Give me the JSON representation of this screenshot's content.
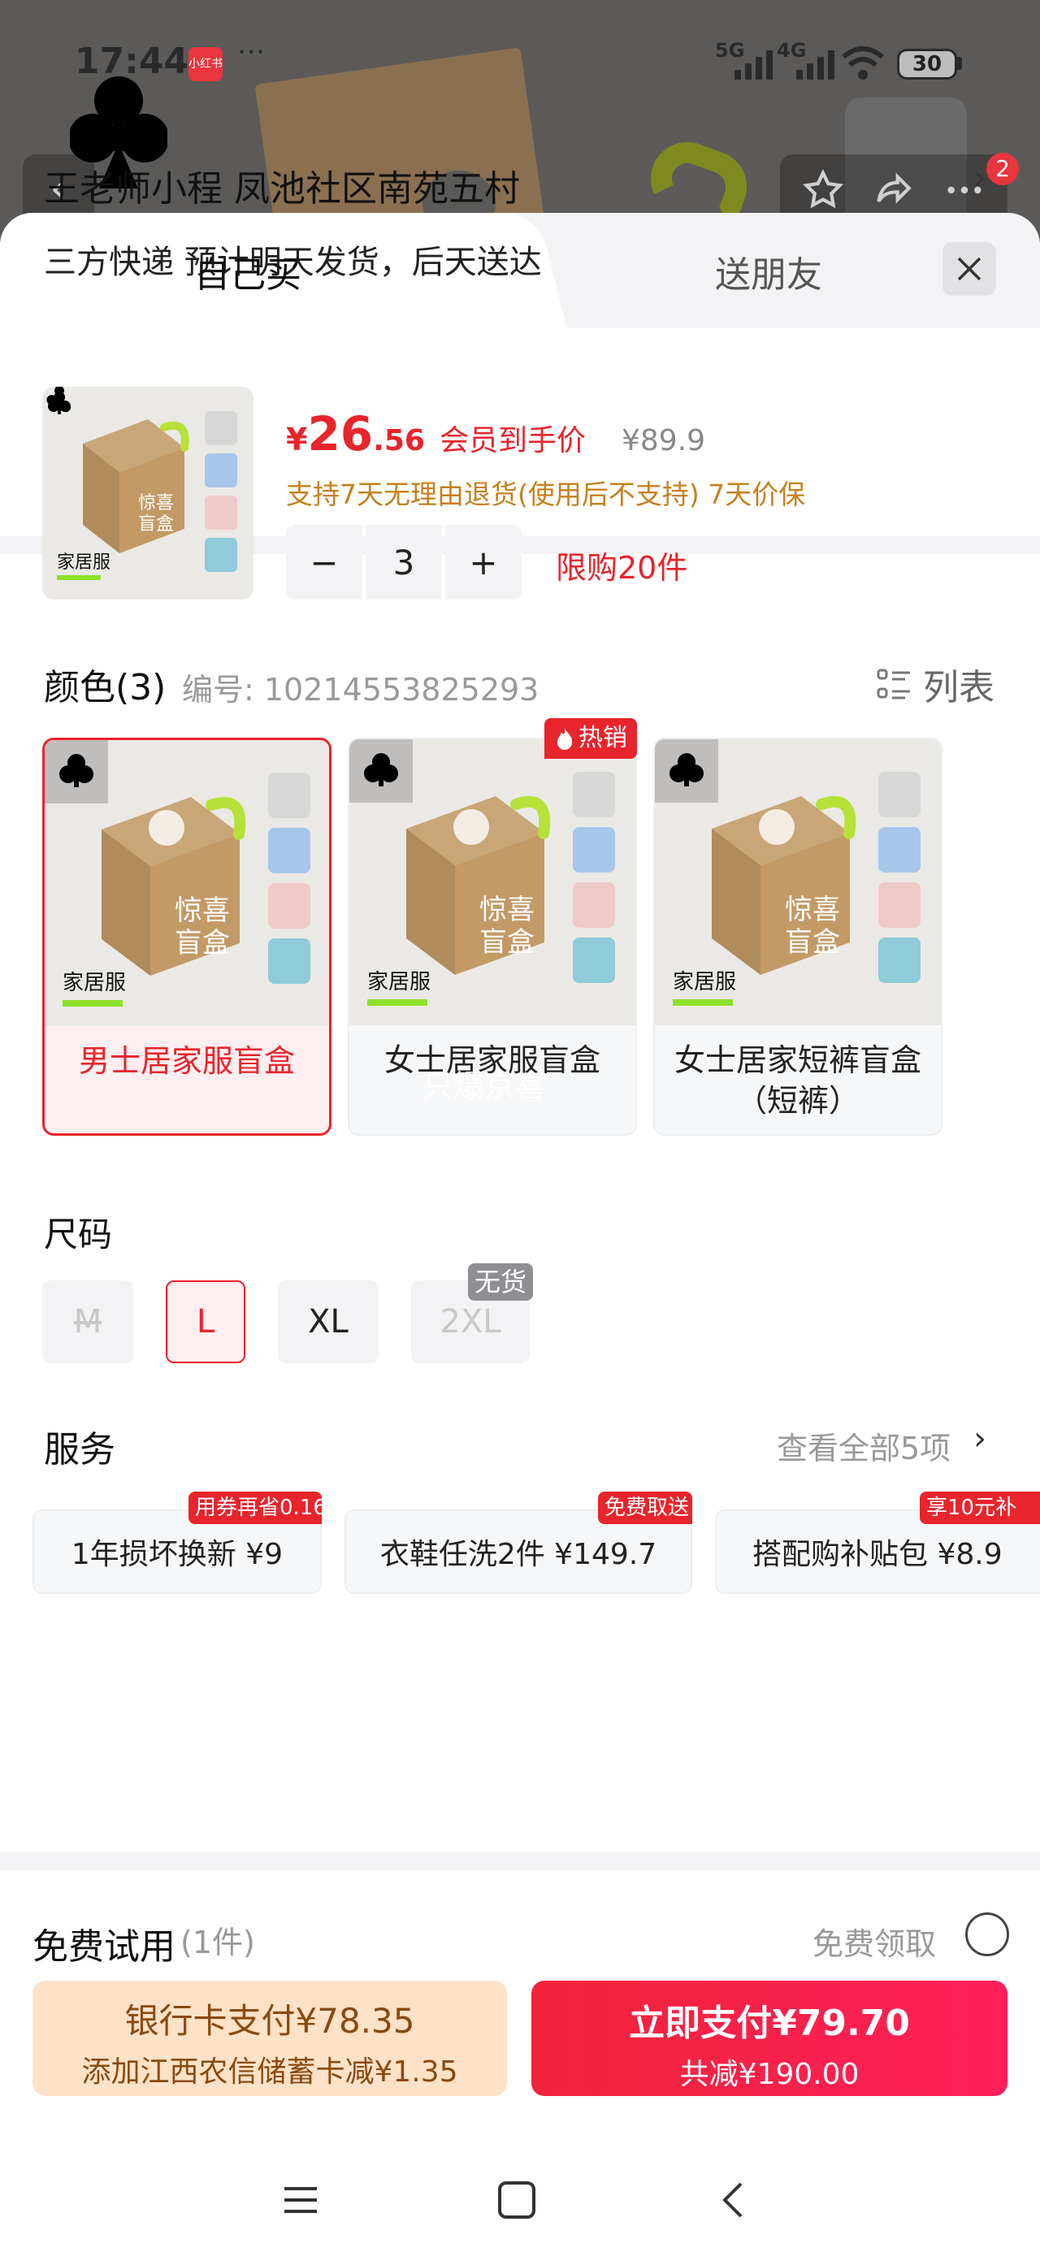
{
  "status_bar": {
    "time": "17:44",
    "app_badge": "小红书",
    "more": "···",
    "network_5g": "5G",
    "network_4g": "4G",
    "battery": "30"
  },
  "background": {
    "notification_count": "2"
  },
  "tabs": {
    "self_buy": "自己买",
    "gift_friend": "送朋友"
  },
  "address": {
    "name_and_location": "王老师小程  凤池社区南苑五村",
    "delivery": "三方快递 预计明天发货，后天送达",
    "arrow": "›"
  },
  "product": {
    "thumb_label": "家居服",
    "currency": "¥",
    "price_int": "26",
    "price_dec": ".56",
    "price_tag": "会员到手价",
    "original_price": "¥89.9",
    "policy": "支持7天无理由退货(使用后不支持) 7天价保",
    "quantity": "3",
    "minus": "−",
    "plus": "+",
    "limit": "限购20件"
  },
  "color_section": {
    "title": "颜色(3)",
    "code": "编号: 10214553825293",
    "list_label": "列表",
    "hot_badge": "热销",
    "overlay_text": "只爆京喜",
    "variants": [
      {
        "name": "男士居家服盲盒",
        "img_label": "家居服",
        "box_text": "惊喜盲盒",
        "selected": true
      },
      {
        "name": "女士居家服盲盒",
        "img_label": "家居服",
        "box_text": "惊喜盲盒",
        "selected": false
      },
      {
        "name": "女士居家短裤盲盒（短裤）",
        "img_label": "家居服",
        "box_text": "惊喜盲盒",
        "selected": false
      }
    ]
  },
  "size_section": {
    "title": "尺码",
    "sizes": [
      "M",
      "L",
      "XL",
      "2XL"
    ],
    "out_of_stock": "无货"
  },
  "service_section": {
    "title": "服务",
    "view_all": "查看全部5项",
    "arrow": "›",
    "items": [
      {
        "label": "1年损坏换新   ¥9",
        "badge": "用券再省0.16"
      },
      {
        "label": "衣鞋任洗2件   ¥149.7",
        "badge": "免费取送"
      },
      {
        "label": "搭配购补贴包   ¥8.9",
        "badge": "享10元补"
      }
    ]
  },
  "trial": {
    "title": "免费试用",
    "count": "(1件)",
    "claim": "免费领取"
  },
  "payment": {
    "bank_line1": "银行卡支付¥78.35",
    "bank_line2": "添加江西农信储蓄卡减¥1.35",
    "now_line1": "立即支付¥79.70",
    "now_line2": "共减¥190.00"
  },
  "colors": {
    "accent": "#e8242c",
    "policy": "#c5801c",
    "bank_bg": "#fde2c7",
    "bank_text": "#8a4a10"
  }
}
